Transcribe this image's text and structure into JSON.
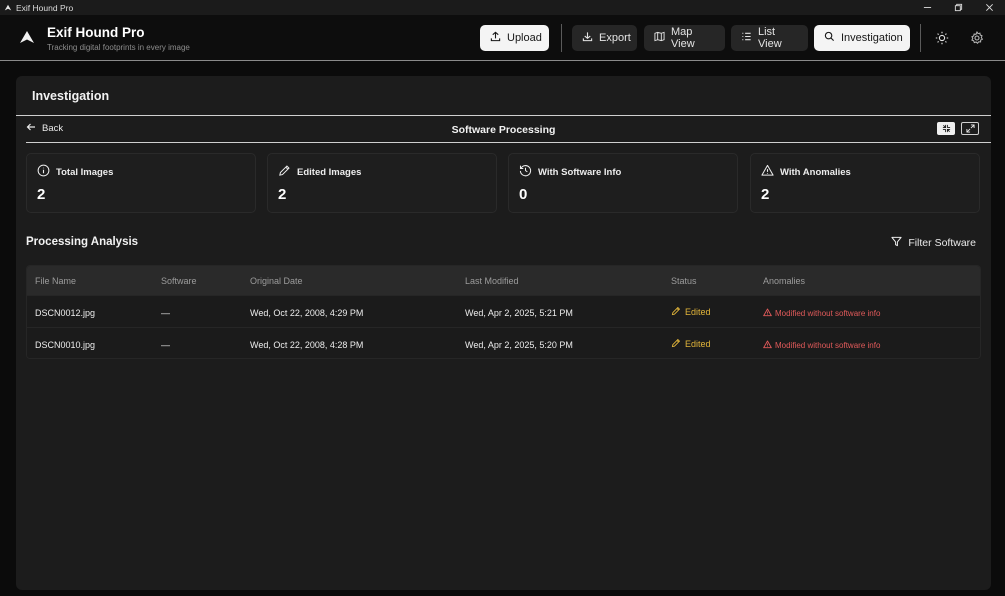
{
  "window": {
    "title": "Exif Hound Pro"
  },
  "brand": {
    "title": "Exif Hound Pro",
    "subtitle": "Tracking digital footprints in every image"
  },
  "toolbar": {
    "upload": "Upload",
    "export": "Export",
    "map_view": "Map View",
    "list_view": "List View",
    "investigation": "Investigation"
  },
  "panel": {
    "title": "Investigation",
    "back": "Back",
    "section_title": "Software Processing"
  },
  "stats": [
    {
      "label": "Total Images",
      "value": "2",
      "icon": "info-icon"
    },
    {
      "label": "Edited Images",
      "value": "2",
      "icon": "pencil-icon"
    },
    {
      "label": "With Software Info",
      "value": "0",
      "icon": "history-icon"
    },
    {
      "label": "With Anomalies",
      "value": "2",
      "icon": "warning-icon"
    }
  ],
  "analysis": {
    "title": "Processing Analysis",
    "filter": "Filter Software"
  },
  "table": {
    "columns": [
      "File Name",
      "Software",
      "Original Date",
      "Last Modified",
      "Status",
      "Anomalies"
    ],
    "rows": [
      {
        "file": "DSCN0012.jpg",
        "software": "—",
        "original": "Wed, Oct 22, 2008, 4:29 PM",
        "modified": "Wed, Apr 2, 2025, 5:21 PM",
        "status": "Edited",
        "anomaly": "Modified without software info"
      },
      {
        "file": "DSCN0010.jpg",
        "software": "—",
        "original": "Wed, Oct 22, 2008, 4:28 PM",
        "modified": "Wed, Apr 2, 2025, 5:20 PM",
        "status": "Edited",
        "anomaly": "Modified without software info"
      }
    ]
  },
  "colors": {
    "edited": "#e2b53a",
    "anomaly": "#e15a5a",
    "accent_light": "#f4f4f4"
  }
}
